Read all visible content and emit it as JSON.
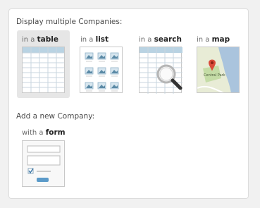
{
  "section_display": {
    "heading": "Display multiple Companies:",
    "options": [
      {
        "prefix": "in a ",
        "keyword": "table"
      },
      {
        "prefix": "in a ",
        "keyword": "list"
      },
      {
        "prefix": "in a ",
        "keyword": "search"
      },
      {
        "prefix": "in a ",
        "keyword": "map"
      }
    ],
    "selected": "table"
  },
  "map_label": "Central Park",
  "section_add": {
    "heading": "Add a new Company:",
    "option": {
      "prefix": "with a ",
      "keyword": "form"
    }
  },
  "colors": {
    "accent_header": "#b9d3e3",
    "map_water": "#aac4dd",
    "map_land": "#e8ecd6",
    "map_park": "#c4dca6",
    "pin": "#d94b3a",
    "form_button": "#5b9ac9"
  },
  "icons": [
    "table-thumbnail-icon",
    "list-thumbnail-icon",
    "search-thumbnail-icon",
    "map-thumbnail-icon",
    "form-thumbnail-icon",
    "magnifier-icon",
    "map-pin-icon",
    "checkbox-icon"
  ]
}
